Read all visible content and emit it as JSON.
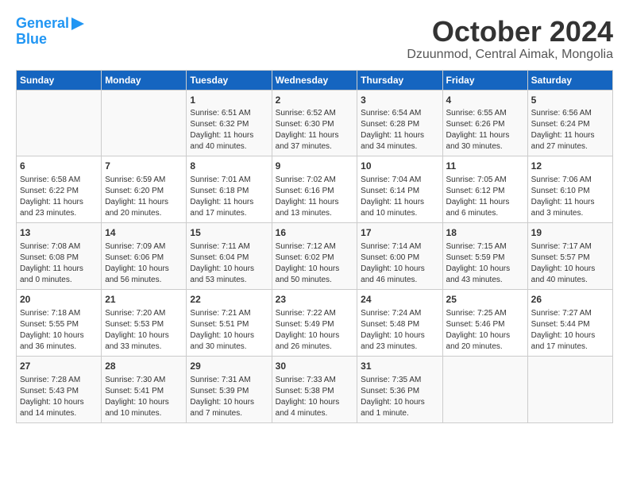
{
  "header": {
    "logo_line1": "General",
    "logo_line2": "Blue",
    "month": "October 2024",
    "location": "Dzuunmod, Central Aimak, Mongolia"
  },
  "weekdays": [
    "Sunday",
    "Monday",
    "Tuesday",
    "Wednesday",
    "Thursday",
    "Friday",
    "Saturday"
  ],
  "weeks": [
    [
      {
        "day": "",
        "info": ""
      },
      {
        "day": "",
        "info": ""
      },
      {
        "day": "1",
        "info": "Sunrise: 6:51 AM\nSunset: 6:32 PM\nDaylight: 11 hours and 40 minutes."
      },
      {
        "day": "2",
        "info": "Sunrise: 6:52 AM\nSunset: 6:30 PM\nDaylight: 11 hours and 37 minutes."
      },
      {
        "day": "3",
        "info": "Sunrise: 6:54 AM\nSunset: 6:28 PM\nDaylight: 11 hours and 34 minutes."
      },
      {
        "day": "4",
        "info": "Sunrise: 6:55 AM\nSunset: 6:26 PM\nDaylight: 11 hours and 30 minutes."
      },
      {
        "day": "5",
        "info": "Sunrise: 6:56 AM\nSunset: 6:24 PM\nDaylight: 11 hours and 27 minutes."
      }
    ],
    [
      {
        "day": "6",
        "info": "Sunrise: 6:58 AM\nSunset: 6:22 PM\nDaylight: 11 hours and 23 minutes."
      },
      {
        "day": "7",
        "info": "Sunrise: 6:59 AM\nSunset: 6:20 PM\nDaylight: 11 hours and 20 minutes."
      },
      {
        "day": "8",
        "info": "Sunrise: 7:01 AM\nSunset: 6:18 PM\nDaylight: 11 hours and 17 minutes."
      },
      {
        "day": "9",
        "info": "Sunrise: 7:02 AM\nSunset: 6:16 PM\nDaylight: 11 hours and 13 minutes."
      },
      {
        "day": "10",
        "info": "Sunrise: 7:04 AM\nSunset: 6:14 PM\nDaylight: 11 hours and 10 minutes."
      },
      {
        "day": "11",
        "info": "Sunrise: 7:05 AM\nSunset: 6:12 PM\nDaylight: 11 hours and 6 minutes."
      },
      {
        "day": "12",
        "info": "Sunrise: 7:06 AM\nSunset: 6:10 PM\nDaylight: 11 hours and 3 minutes."
      }
    ],
    [
      {
        "day": "13",
        "info": "Sunrise: 7:08 AM\nSunset: 6:08 PM\nDaylight: 11 hours and 0 minutes."
      },
      {
        "day": "14",
        "info": "Sunrise: 7:09 AM\nSunset: 6:06 PM\nDaylight: 10 hours and 56 minutes."
      },
      {
        "day": "15",
        "info": "Sunrise: 7:11 AM\nSunset: 6:04 PM\nDaylight: 10 hours and 53 minutes."
      },
      {
        "day": "16",
        "info": "Sunrise: 7:12 AM\nSunset: 6:02 PM\nDaylight: 10 hours and 50 minutes."
      },
      {
        "day": "17",
        "info": "Sunrise: 7:14 AM\nSunset: 6:00 PM\nDaylight: 10 hours and 46 minutes."
      },
      {
        "day": "18",
        "info": "Sunrise: 7:15 AM\nSunset: 5:59 PM\nDaylight: 10 hours and 43 minutes."
      },
      {
        "day": "19",
        "info": "Sunrise: 7:17 AM\nSunset: 5:57 PM\nDaylight: 10 hours and 40 minutes."
      }
    ],
    [
      {
        "day": "20",
        "info": "Sunrise: 7:18 AM\nSunset: 5:55 PM\nDaylight: 10 hours and 36 minutes."
      },
      {
        "day": "21",
        "info": "Sunrise: 7:20 AM\nSunset: 5:53 PM\nDaylight: 10 hours and 33 minutes."
      },
      {
        "day": "22",
        "info": "Sunrise: 7:21 AM\nSunset: 5:51 PM\nDaylight: 10 hours and 30 minutes."
      },
      {
        "day": "23",
        "info": "Sunrise: 7:22 AM\nSunset: 5:49 PM\nDaylight: 10 hours and 26 minutes."
      },
      {
        "day": "24",
        "info": "Sunrise: 7:24 AM\nSunset: 5:48 PM\nDaylight: 10 hours and 23 minutes."
      },
      {
        "day": "25",
        "info": "Sunrise: 7:25 AM\nSunset: 5:46 PM\nDaylight: 10 hours and 20 minutes."
      },
      {
        "day": "26",
        "info": "Sunrise: 7:27 AM\nSunset: 5:44 PM\nDaylight: 10 hours and 17 minutes."
      }
    ],
    [
      {
        "day": "27",
        "info": "Sunrise: 7:28 AM\nSunset: 5:43 PM\nDaylight: 10 hours and 14 minutes."
      },
      {
        "day": "28",
        "info": "Sunrise: 7:30 AM\nSunset: 5:41 PM\nDaylight: 10 hours and 10 minutes."
      },
      {
        "day": "29",
        "info": "Sunrise: 7:31 AM\nSunset: 5:39 PM\nDaylight: 10 hours and 7 minutes."
      },
      {
        "day": "30",
        "info": "Sunrise: 7:33 AM\nSunset: 5:38 PM\nDaylight: 10 hours and 4 minutes."
      },
      {
        "day": "31",
        "info": "Sunrise: 7:35 AM\nSunset: 5:36 PM\nDaylight: 10 hours and 1 minute."
      },
      {
        "day": "",
        "info": ""
      },
      {
        "day": "",
        "info": ""
      }
    ]
  ]
}
